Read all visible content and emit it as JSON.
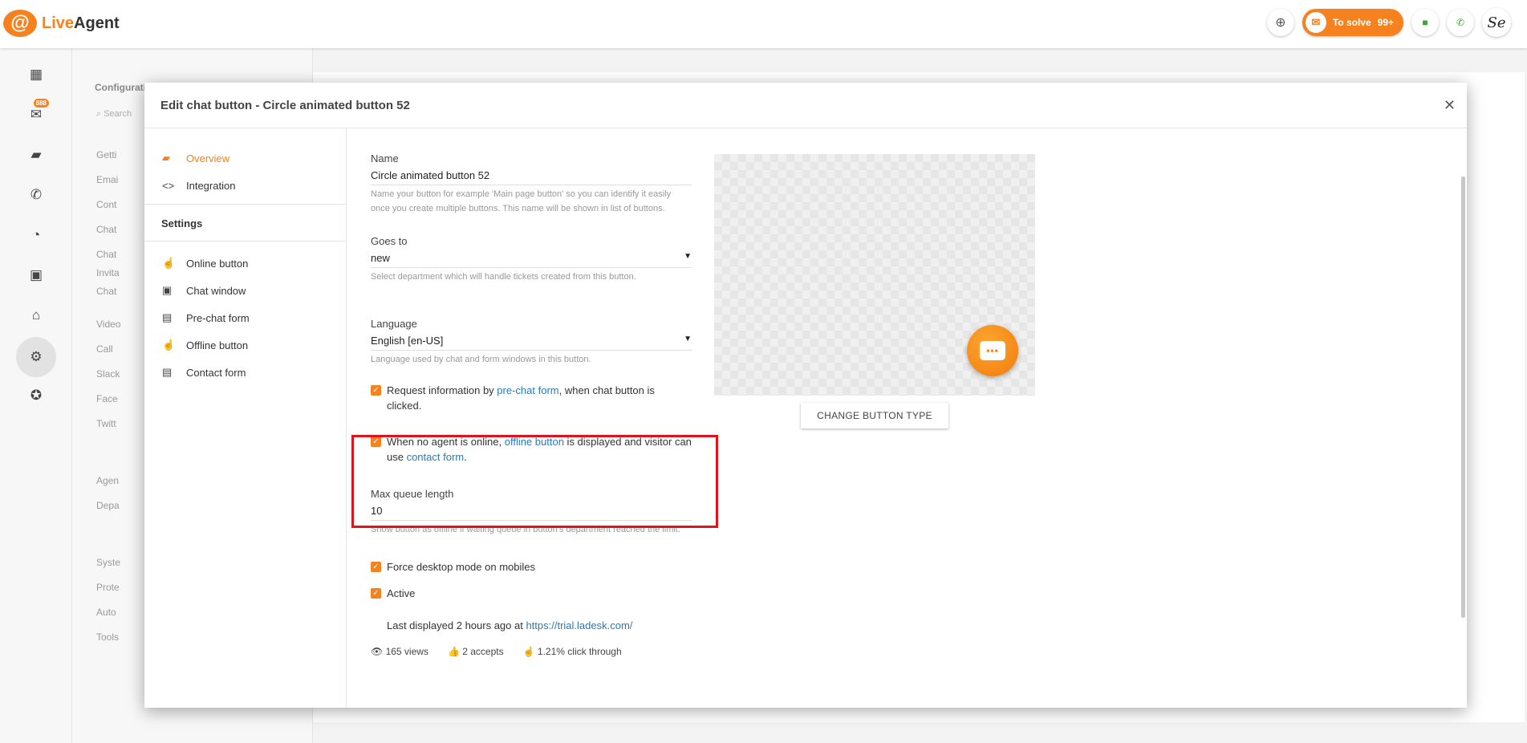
{
  "app": {
    "logo_text_live": "Live",
    "logo_text_agent": "Agent"
  },
  "topbar": {
    "solve_label": "To solve",
    "solve_count": "99+"
  },
  "avatar_text": "Se",
  "rail": {
    "mail_badge": "888"
  },
  "config": {
    "title": "Configurati",
    "search_placeholder": "Search",
    "items": [
      "Getti",
      "Emai",
      "Cont",
      "Chat",
      "Chat",
      "Invita",
      "Chat",
      "Video",
      "Call",
      "Slack",
      "Face",
      "Twitt",
      "Agen",
      "Depa",
      "Syste",
      "Prote",
      "Auto",
      "Tools"
    ]
  },
  "dialog": {
    "title": "Edit chat button - Circle animated button 52",
    "nav": {
      "overview": "Overview",
      "integration": "Integration",
      "settings": "Settings",
      "online_button": "Online button",
      "chat_window": "Chat window",
      "prechat_form": "Pre-chat form",
      "offline_button": "Offline button",
      "contact_form": "Contact form"
    },
    "name": {
      "label": "Name",
      "value": "Circle animated button 52",
      "help": "Name your button for example 'Main page button' so you can identify it easily once you create multiple buttons. This name will be shown in list of buttons."
    },
    "goes_to": {
      "label": "Goes to",
      "value": "new",
      "help": "Select department which will handle tickets created from this button."
    },
    "language": {
      "label": "Language",
      "value": "English [en-US]",
      "help": "Language used by chat and form windows in this button."
    },
    "request_info": {
      "pre": "Request information by ",
      "link": "pre-chat form",
      "post": ", when chat button is clicked."
    },
    "no_agent": {
      "pre": "When no agent is online, ",
      "link1": "offline button",
      "mid": " is displayed and visitor can use ",
      "link2": "contact form",
      "post": "."
    },
    "max_queue": {
      "label": "Max queue length",
      "value": "10",
      "help": "Show button as offline if waiting queue in button's department reached the limit."
    },
    "force_desktop": "Force desktop mode on mobiles",
    "active": "Active",
    "last_displayed": {
      "pre": "Last displayed 2 hours ago at ",
      "link": "https://trial.ladesk.com/"
    },
    "stats": {
      "views": "165 views",
      "accepts": "2 accepts",
      "click_through": "1.21% click through"
    },
    "change_button_type": "CHANGE BUTTON TYPE"
  },
  "colors": {
    "accent": "#f5821f",
    "link": "#2a7ab8",
    "highlight": "#e0121b"
  }
}
